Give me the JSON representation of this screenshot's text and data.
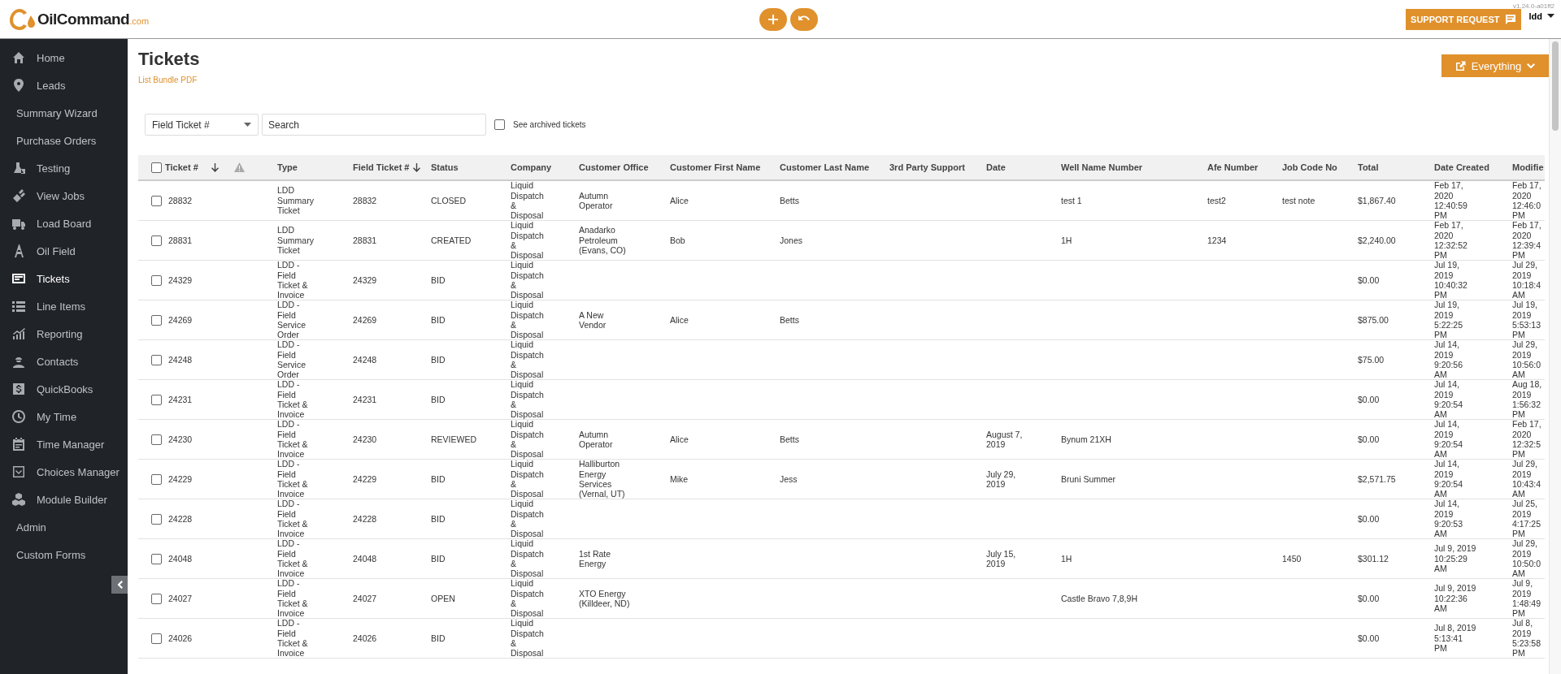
{
  "header": {
    "logo": {
      "name": "OilCommand",
      "suffix": ".com"
    },
    "version": "v1.24.0-a01ff2",
    "support_button": "SUPPORT REQUEST",
    "user": "ldd"
  },
  "sidebar": {
    "items": [
      {
        "label": "Home",
        "kind": "icon",
        "selected": false
      },
      {
        "label": "Leads",
        "kind": "icon",
        "selected": false
      },
      {
        "label": "Summary Wizard",
        "kind": "text",
        "selected": false
      },
      {
        "label": "Purchase Orders",
        "kind": "text",
        "selected": false
      },
      {
        "label": "Testing",
        "kind": "icon",
        "selected": false
      },
      {
        "label": "View Jobs",
        "kind": "icon",
        "selected": false
      },
      {
        "label": "Load Board",
        "kind": "icon",
        "selected": false
      },
      {
        "label": "Oil Field",
        "kind": "icon",
        "selected": false
      },
      {
        "label": "Tickets",
        "kind": "icon",
        "selected": true
      },
      {
        "label": "Line Items",
        "kind": "icon",
        "selected": false
      },
      {
        "label": "Reporting",
        "kind": "icon",
        "selected": false
      },
      {
        "label": "Contacts",
        "kind": "icon",
        "selected": false
      },
      {
        "label": "QuickBooks",
        "kind": "icon",
        "selected": false
      },
      {
        "label": "My Time",
        "kind": "icon",
        "selected": false
      },
      {
        "label": "Time Manager",
        "kind": "icon",
        "selected": false
      },
      {
        "label": "Choices Manager",
        "kind": "icon",
        "selected": false
      },
      {
        "label": "Module Builder",
        "kind": "icon",
        "selected": false
      },
      {
        "label": "Admin",
        "kind": "text",
        "selected": false
      },
      {
        "label": "Custom Forms",
        "kind": "text",
        "selected": false
      }
    ]
  },
  "page": {
    "title": "Tickets",
    "link": "List Bundle PDF",
    "scope_button": "Everything"
  },
  "filters": {
    "field_select": "Field Ticket #",
    "search": {
      "placeholder": "Search"
    },
    "archived": {
      "label": "See archived tickets",
      "checked": false
    }
  },
  "table": {
    "select_all": {
      "checked": false
    },
    "columns": [
      {
        "label": "Ticket #",
        "sorted": true
      },
      {
        "label": "Type",
        "sorted": false
      },
      {
        "label": "Field Ticket #",
        "sorted": true
      },
      {
        "label": "Status",
        "sorted": false
      },
      {
        "label": "Company",
        "sorted": false
      },
      {
        "label": "Customer Office",
        "sorted": false
      },
      {
        "label": "Customer First Name",
        "sorted": false
      },
      {
        "label": "Customer Last Name",
        "sorted": false
      },
      {
        "label": "3rd Party Support",
        "sorted": false
      },
      {
        "label": "Date",
        "sorted": false
      },
      {
        "label": "Well Name Number",
        "sorted": false
      },
      {
        "label": "Afe Number",
        "sorted": false
      },
      {
        "label": "Job Code No",
        "sorted": false
      },
      {
        "label": "Total",
        "sorted": false
      },
      {
        "label": "Date Created",
        "sorted": false
      },
      {
        "label": "Modifie",
        "sorted": false
      }
    ],
    "rows": [
      {
        "checked": false,
        "ticket": "28832",
        "type": "LDD Summary Ticket",
        "field_ticket": "28832",
        "status": "CLOSED",
        "company": "Liquid Dispatch & Disposal",
        "customer_office": "Autumn Operator",
        "first_name": "Alice",
        "last_name": "Betts",
        "well": "test 1",
        "afe": "test2",
        "job_code": "test note",
        "total": "$1,867.40",
        "date_created": "Feb 17, 2020 12:40:59 PM",
        "modified": "Feb 17, 2020 12:46:0 PM"
      },
      {
        "checked": false,
        "ticket": "28831",
        "type": "LDD Summary Ticket",
        "field_ticket": "28831",
        "status": "CREATED",
        "company": "Liquid Dispatch & Disposal",
        "customer_office": "Anadarko Petroleum (Evans, CO)",
        "first_name": "Bob",
        "last_name": "Jones",
        "well": "1H",
        "afe": "1234",
        "total": "$2,240.00",
        "date_created": "Feb 17, 2020 12:32:52 PM",
        "modified": "Feb 17, 2020 12:39:4 PM"
      },
      {
        "checked": false,
        "ticket": "24329",
        "type": "LDD - Field Ticket & Invoice",
        "field_ticket": "24329",
        "status": "BID",
        "company": "Liquid Dispatch & Disposal",
        "total": "$0.00",
        "date_created": "Jul 19, 2019 10:40:32 PM",
        "modified": "Jul 29, 2019 10:18:4 AM"
      },
      {
        "checked": false,
        "ticket": "24269",
        "type": "LDD - Field Service Order",
        "field_ticket": "24269",
        "status": "BID",
        "company": "Liquid Dispatch & Disposal",
        "customer_office": "A New Vendor",
        "first_name": "Alice",
        "last_name": "Betts",
        "total": "$875.00",
        "date_created": "Jul 19, 2019 5:22:25 PM",
        "modified": "Jul 19, 2019 5:53:13 PM"
      },
      {
        "checked": false,
        "ticket": "24248",
        "type": "LDD - Field Service Order",
        "field_ticket": "24248",
        "status": "BID",
        "company": "Liquid Dispatch & Disposal",
        "total": "$75.00",
        "date_created": "Jul 14, 2019 9:20:56 AM",
        "modified": "Jul 29, 2019 10:56:0 AM"
      },
      {
        "checked": false,
        "ticket": "24231",
        "type": "LDD - Field Ticket & Invoice",
        "field_ticket": "24231",
        "status": "BID",
        "company": "Liquid Dispatch & Disposal",
        "total": "$0.00",
        "date_created": "Jul 14, 2019 9:20:54 AM",
        "modified": "Aug 18, 2019 1:56:32 PM"
      },
      {
        "checked": false,
        "ticket": "24230",
        "type": "LDD - Field Ticket & Invoice",
        "field_ticket": "24230",
        "status": "REVIEWED",
        "company": "Liquid Dispatch & Disposal",
        "customer_office": "Autumn Operator",
        "first_name": "Alice",
        "last_name": "Betts",
        "date": "August 7, 2019",
        "well": "Bynum 21XH",
        "total": "$0.00",
        "date_created": "Jul 14, 2019 9:20:54 AM",
        "modified": "Feb 17, 2020 12:32:5 PM"
      },
      {
        "checked": false,
        "ticket": "24229",
        "type": "LDD - Field Ticket & Invoice",
        "field_ticket": "24229",
        "status": "BID",
        "company": "Liquid Dispatch & Disposal",
        "customer_office": "Halliburton Energy Services (Vernal, UT)",
        "first_name": "Mike",
        "last_name": "Jess",
        "date": "July 29, 2019",
        "well": "Bruni Summer",
        "total": "$2,571.75",
        "date_created": "Jul 14, 2019 9:20:54 AM",
        "modified": "Jul 29, 2019 10:43:4 AM"
      },
      {
        "checked": false,
        "ticket": "24228",
        "type": "LDD - Field Ticket & Invoice",
        "field_ticket": "24228",
        "status": "BID",
        "company": "Liquid Dispatch & Disposal",
        "total": "$0.00",
        "date_created": "Jul 14, 2019 9:20:53 AM",
        "modified": "Jul 25, 2019 4:17:25 PM"
      },
      {
        "checked": false,
        "ticket": "24048",
        "type": "LDD - Field Ticket & Invoice",
        "field_ticket": "24048",
        "status": "BID",
        "company": "Liquid Dispatch & Disposal",
        "customer_office": "1st Rate Energy",
        "date": "July 15, 2019",
        "well": "1H",
        "job_code": "1450",
        "total": "$301.12",
        "date_created": "Jul 9, 2019 10:25:29 AM",
        "modified": "Jul 29, 2019 10:50:0 AM"
      },
      {
        "checked": false,
        "ticket": "24027",
        "type": "LDD - Field Ticket & Invoice",
        "field_ticket": "24027",
        "status": "OPEN",
        "company": "Liquid Dispatch & Disposal",
        "customer_office": "XTO Energy (Killdeer, ND)",
        "well": "Castle Bravo 7,8,9H",
        "total": "$0.00",
        "date_created": "Jul 9, 2019 10:22:36 AM",
        "modified": "Jul 9, 2019 1:48:49 PM"
      },
      {
        "checked": false,
        "ticket": "24026",
        "type": "LDD - Field Ticket & Invoice",
        "field_ticket": "24026",
        "status": "BID",
        "company": "Liquid Dispatch & Disposal",
        "total": "$0.00",
        "date_created": "Jul 8, 2019 5:13:41 PM",
        "modified": "Jul 8, 2019 5:23:58 PM"
      }
    ]
  }
}
